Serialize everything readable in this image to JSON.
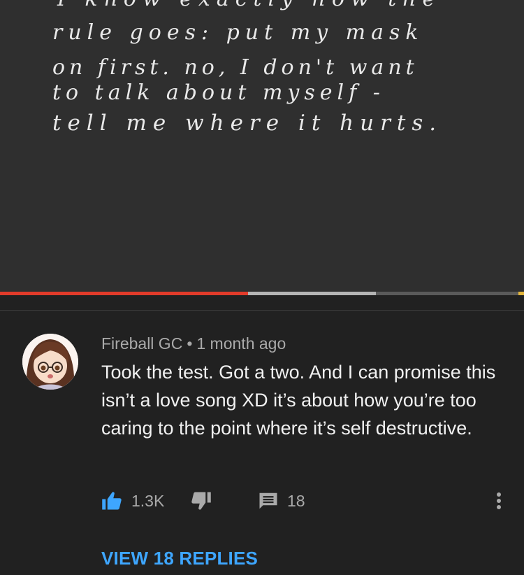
{
  "video": {
    "handwriting_lines": [
      "I know exactly how the",
      "rule goes: put my mask",
      "on first. no, I don't want",
      "to talk about myself -",
      "tell me where it hurts."
    ],
    "progress_played": 0.473,
    "progress_buffered": 0.717
  },
  "comment": {
    "author": "Fireball GC",
    "separator": "•",
    "time": "1 month ago",
    "text": "Took the test. Got a two. And I can promise this isn’t a love song XD it’s about how you’re too caring to the point where it’s self destructive.",
    "likes": "1.3K",
    "reply_count": "18",
    "view_replies_label": "VIEW 18 REPLIES"
  },
  "colors": {
    "background": "#212121",
    "video_background": "#2f2f2f",
    "progress_played": "#e23b2a",
    "like_active": "#3ea6ff",
    "link": "#3ea6ff",
    "secondary_text": "#aaaaaa"
  },
  "icons": {
    "like": "thumbs-up-icon",
    "dislike": "thumbs-down-icon",
    "reply": "comment-icon",
    "more": "more-vertical-icon"
  }
}
